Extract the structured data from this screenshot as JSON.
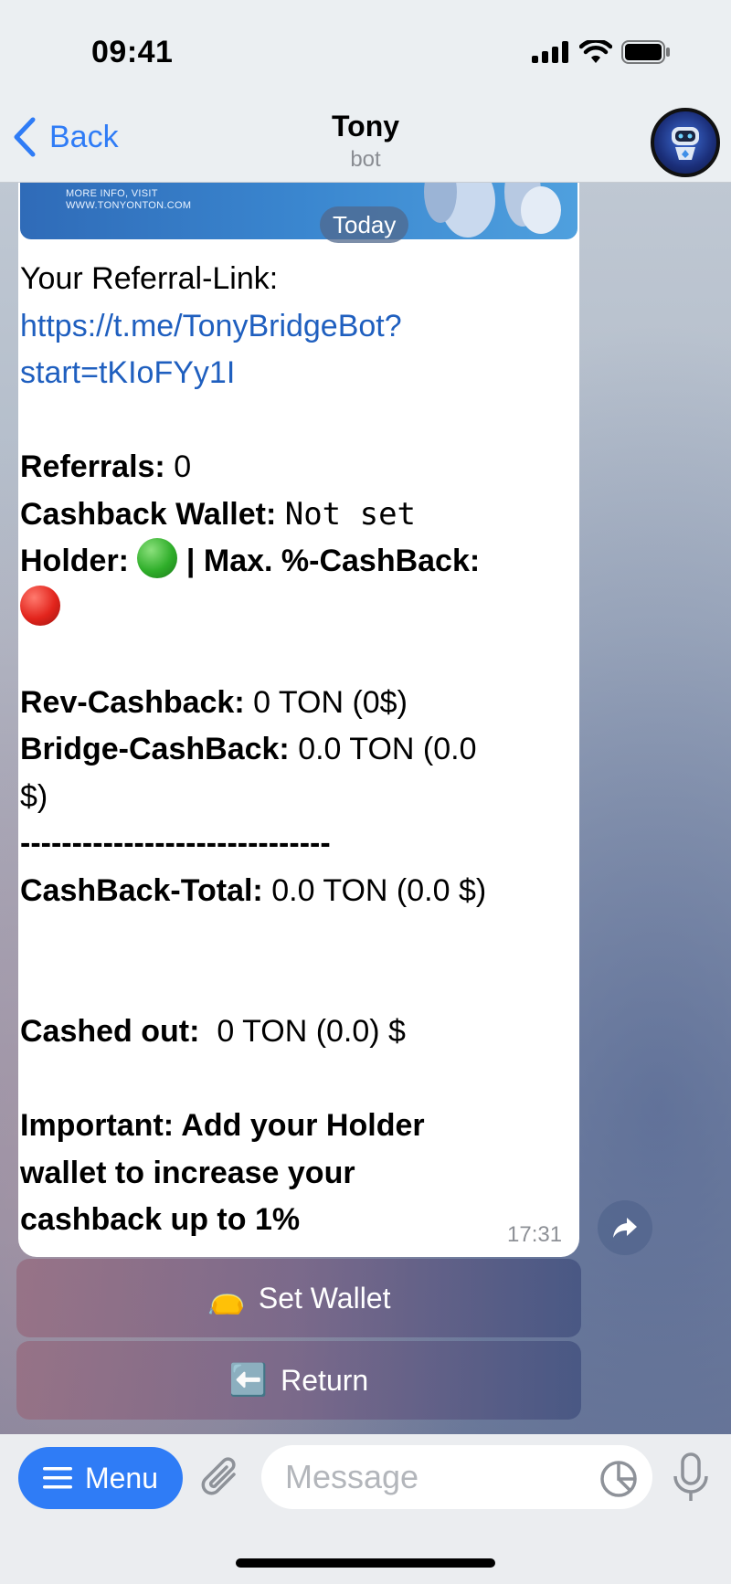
{
  "status_bar": {
    "time": "09:41"
  },
  "header": {
    "back_label": "Back",
    "title": "Tony",
    "subtitle": "bot"
  },
  "banner": {
    "line1": "MORE INFO, VISIT",
    "line2": "WWW.TONYONTON.COM"
  },
  "date_pill": "Today",
  "message": {
    "referral_label": "Your Referral-Link:",
    "referral_link_line1": "https://t.me/TonyBridgeBot?",
    "referral_link_line2": "start=tKIoFYy1I",
    "referrals_label": "Referrals:",
    "referrals_value": "0",
    "wallet_label": "Cashback Wallet:",
    "wallet_value": "Not set",
    "holder_label": "Holder:",
    "holder_sep": "| Max. %-CashBack:",
    "rev_label": "Rev-Cashback:",
    "rev_value": "0 TON (0$)",
    "bridge_label": "Bridge-CashBack:",
    "bridge_value": "0.0 TON (0.0",
    "bridge_value_cont": "$)",
    "divider": "------------------------------",
    "total_label": "CashBack-Total:",
    "total_value": "0.0 TON (0.0 $)",
    "cashed_label": "Cashed out:",
    "cashed_value": "0 TON (0.0) $",
    "important_line1": "Important: Add your Holder",
    "important_line2": "wallet to increase your",
    "important_line3": "cashback up to 1%",
    "time": "17:31"
  },
  "buttons": {
    "set_wallet_emoji": "👝",
    "set_wallet_label": "Set Wallet",
    "return_emoji": "⬅️",
    "return_label": "Return"
  },
  "input_bar": {
    "menu_label": "Menu",
    "placeholder": "Message"
  },
  "colors": {
    "accent": "#2f7cf6",
    "link": "#1f5fbf",
    "green_status": "#2fae2a",
    "red_status": "#e2241c"
  },
  "icons": [
    "back-chevron-icon",
    "signal-icon",
    "wifi-icon",
    "battery-icon",
    "share-icon",
    "menu-lines-icon",
    "paperclip-icon",
    "sticker-icon",
    "microphone-icon"
  ]
}
